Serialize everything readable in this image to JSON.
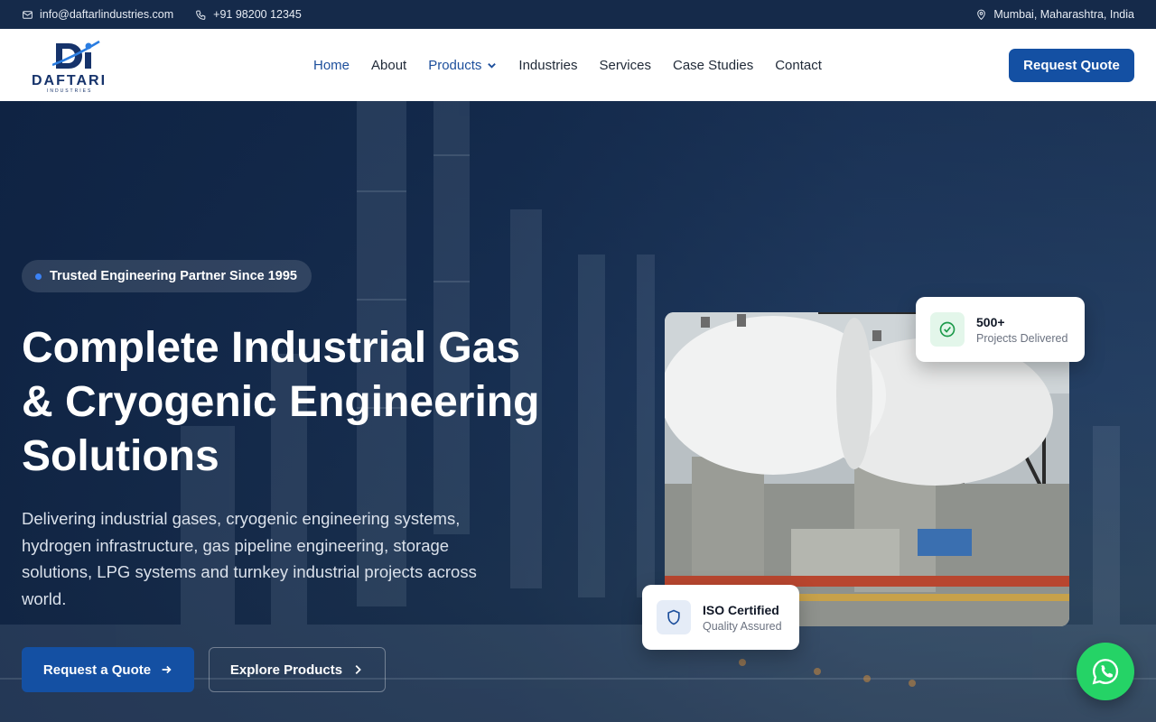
{
  "topbar": {
    "email": "info@daftarlindustries.com",
    "phone": "+91 98200 12345",
    "location": "Mumbai, Maharashtra, India",
    "icons": [
      "mail-icon",
      "phone-icon",
      "map-pin-icon"
    ]
  },
  "nav": {
    "logo_word": "DAFTARI",
    "logo_sub": "INDUSTRIES",
    "links": [
      "Home",
      "About",
      "Products",
      "Industries",
      "Services",
      "Case Studies",
      "Contact"
    ],
    "active": "Home",
    "cta": "Request Quote"
  },
  "hero": {
    "badge": "Trusted Engineering Partner Since 1995",
    "headline_lines": [
      "Complete Industrial Gas",
      "& Cryogenic Engineering",
      "Solutions"
    ],
    "description": "Delivering industrial gases, cryogenic engineering systems, hydrogen infrastructure, gas pipeline engineering, storage solutions, LPG systems and turnkey industrial projects across world.",
    "primary_button": "Request a Quote",
    "secondary_button": "Explore Products"
  },
  "cards": {
    "stat_title": "500+",
    "stat_sub": "Projects Delivered",
    "iso_title": "ISO Certified",
    "iso_sub": "Quality Assured"
  },
  "colors": {
    "brand": "#1450a3",
    "topbar": "#152a4a",
    "whatsapp": "#25d366"
  }
}
